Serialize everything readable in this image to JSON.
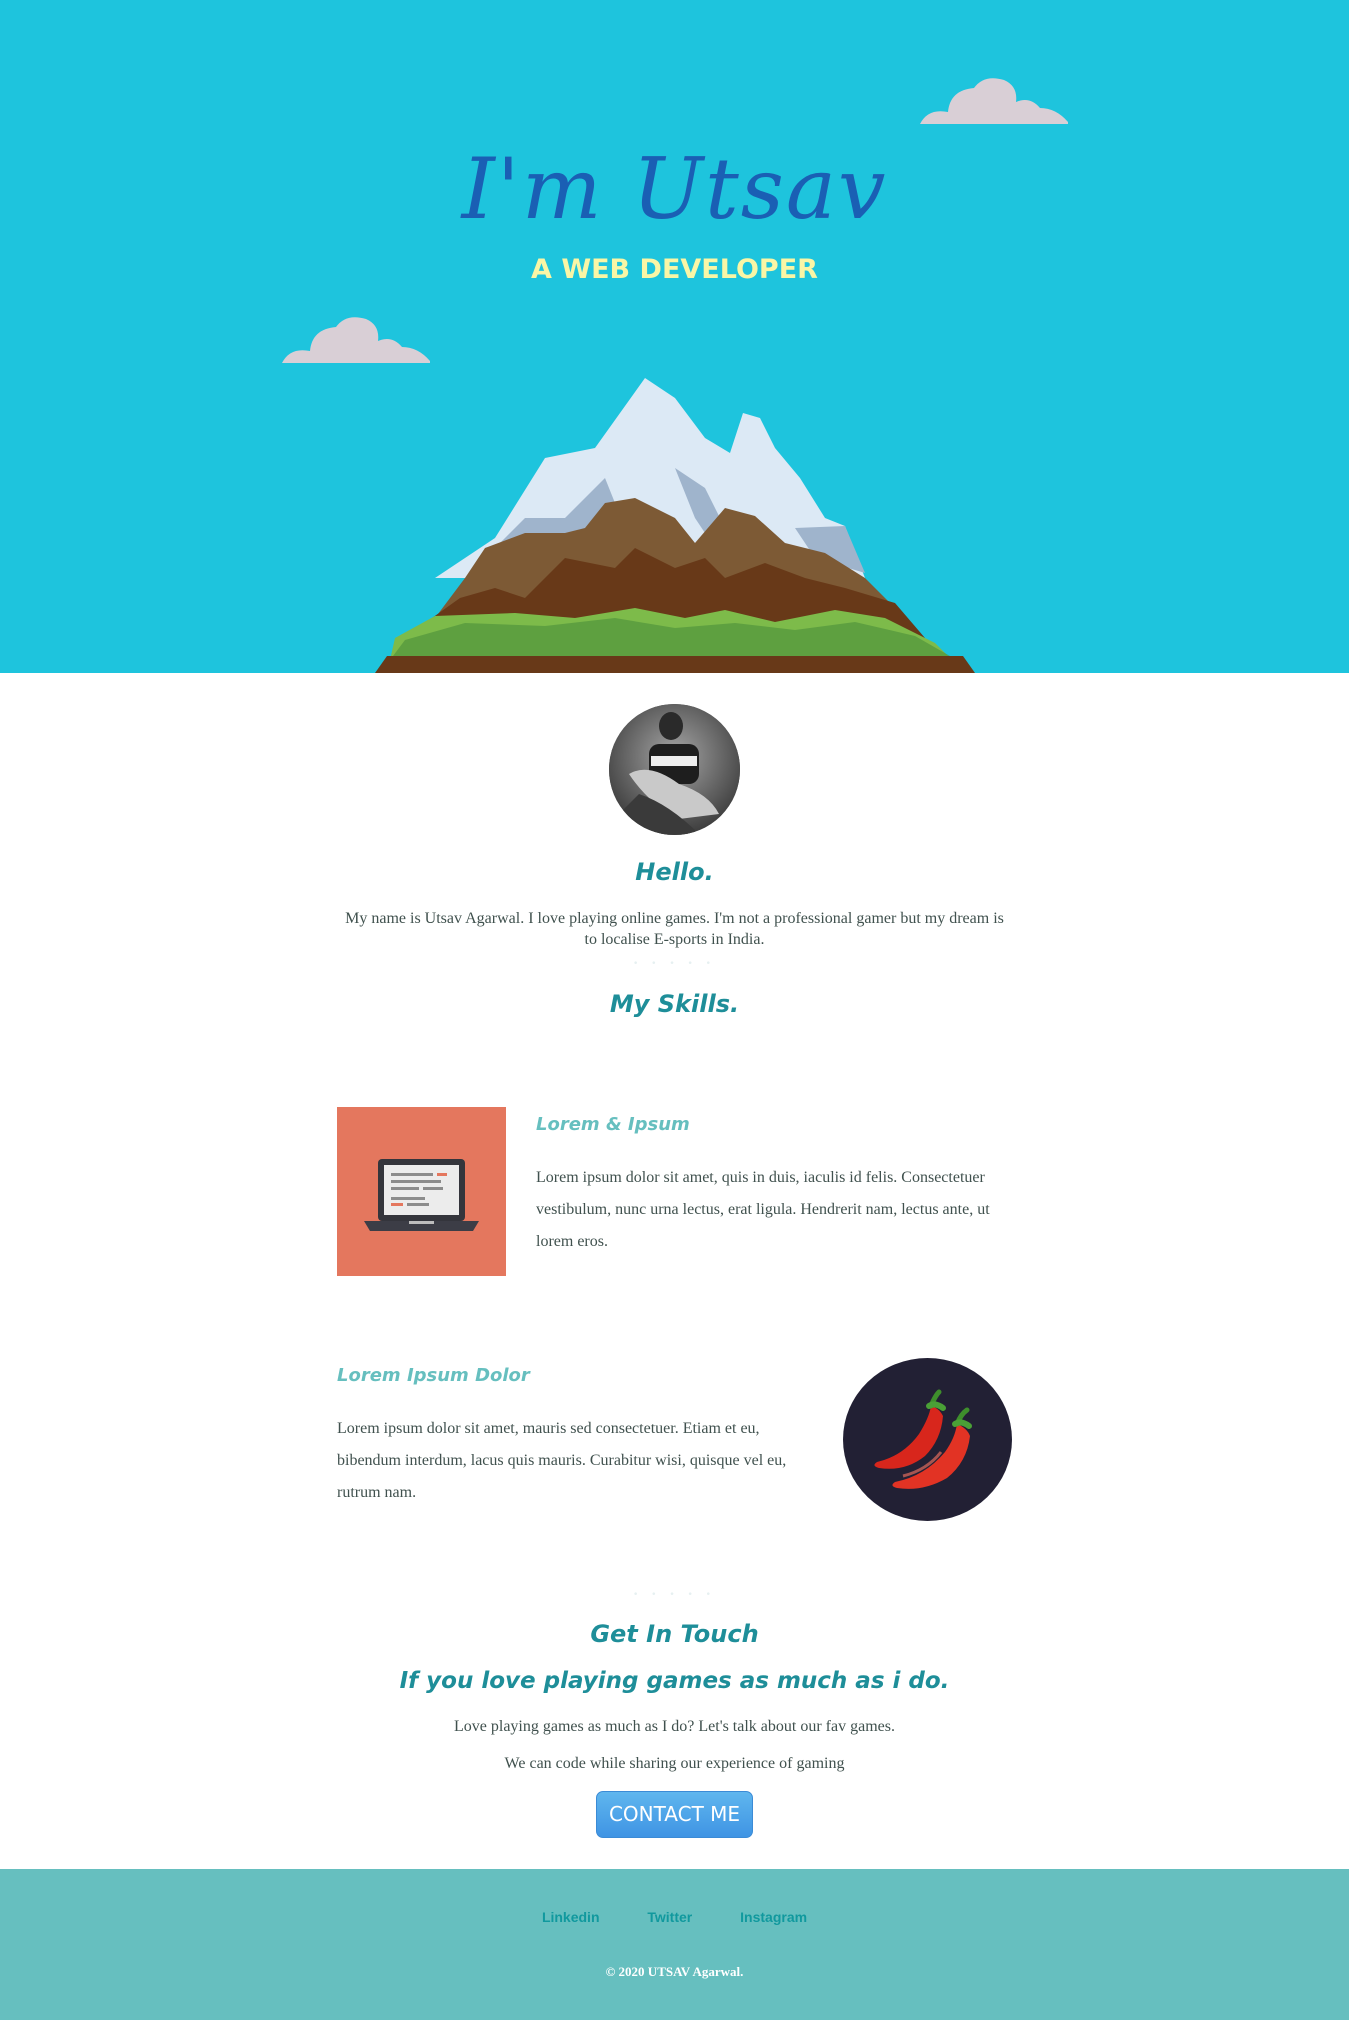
{
  "hero": {
    "title": "I'm Utsav",
    "subtitle": "A WEB DEVELOPER",
    "background_color": "#1ec4dd"
  },
  "about": {
    "avatar_icon": "profile-photo",
    "heading": "Hello.",
    "text": "My name is Utsav Agarwal. I love playing online games. I'm not a professional gamer but my dream is to localise E-sports in India."
  },
  "divider": "• • • • •",
  "skills": {
    "heading": "My Skills.",
    "items": [
      {
        "title": "Lorem & Ipsum",
        "text": "Lorem ipsum dolor sit amet, quis in duis, iaculis id felis. Consectetuer vestibulum, nunc urna lectus, erat ligula. Hendrerit nam, lectus ante, ut lorem eros.",
        "icon": "laptop-icon"
      },
      {
        "title": "Lorem Ipsum Dolor",
        "text": "Lorem ipsum dolor sit amet, mauris sed consectetuer. Etiam et eu, bibendum interdum, lacus quis mauris. Curabitur wisi, quisque vel eu, rutrum nam.",
        "icon": "chili-pepper-icon"
      }
    ]
  },
  "contact": {
    "heading": "Get In Touch",
    "subheading": "If you love playing games as much as i do.",
    "line1": "Love playing games as much as I do? Let's talk about our fav games.",
    "line2": "We can code while sharing our experience of gaming",
    "button_label": "CONTACT ME"
  },
  "footer": {
    "links": [
      "Linkedin",
      "Twitter",
      "Instagram"
    ],
    "copyright": "© 2020 UTSAV Agarwal.",
    "background_color": "#66bfbf"
  }
}
